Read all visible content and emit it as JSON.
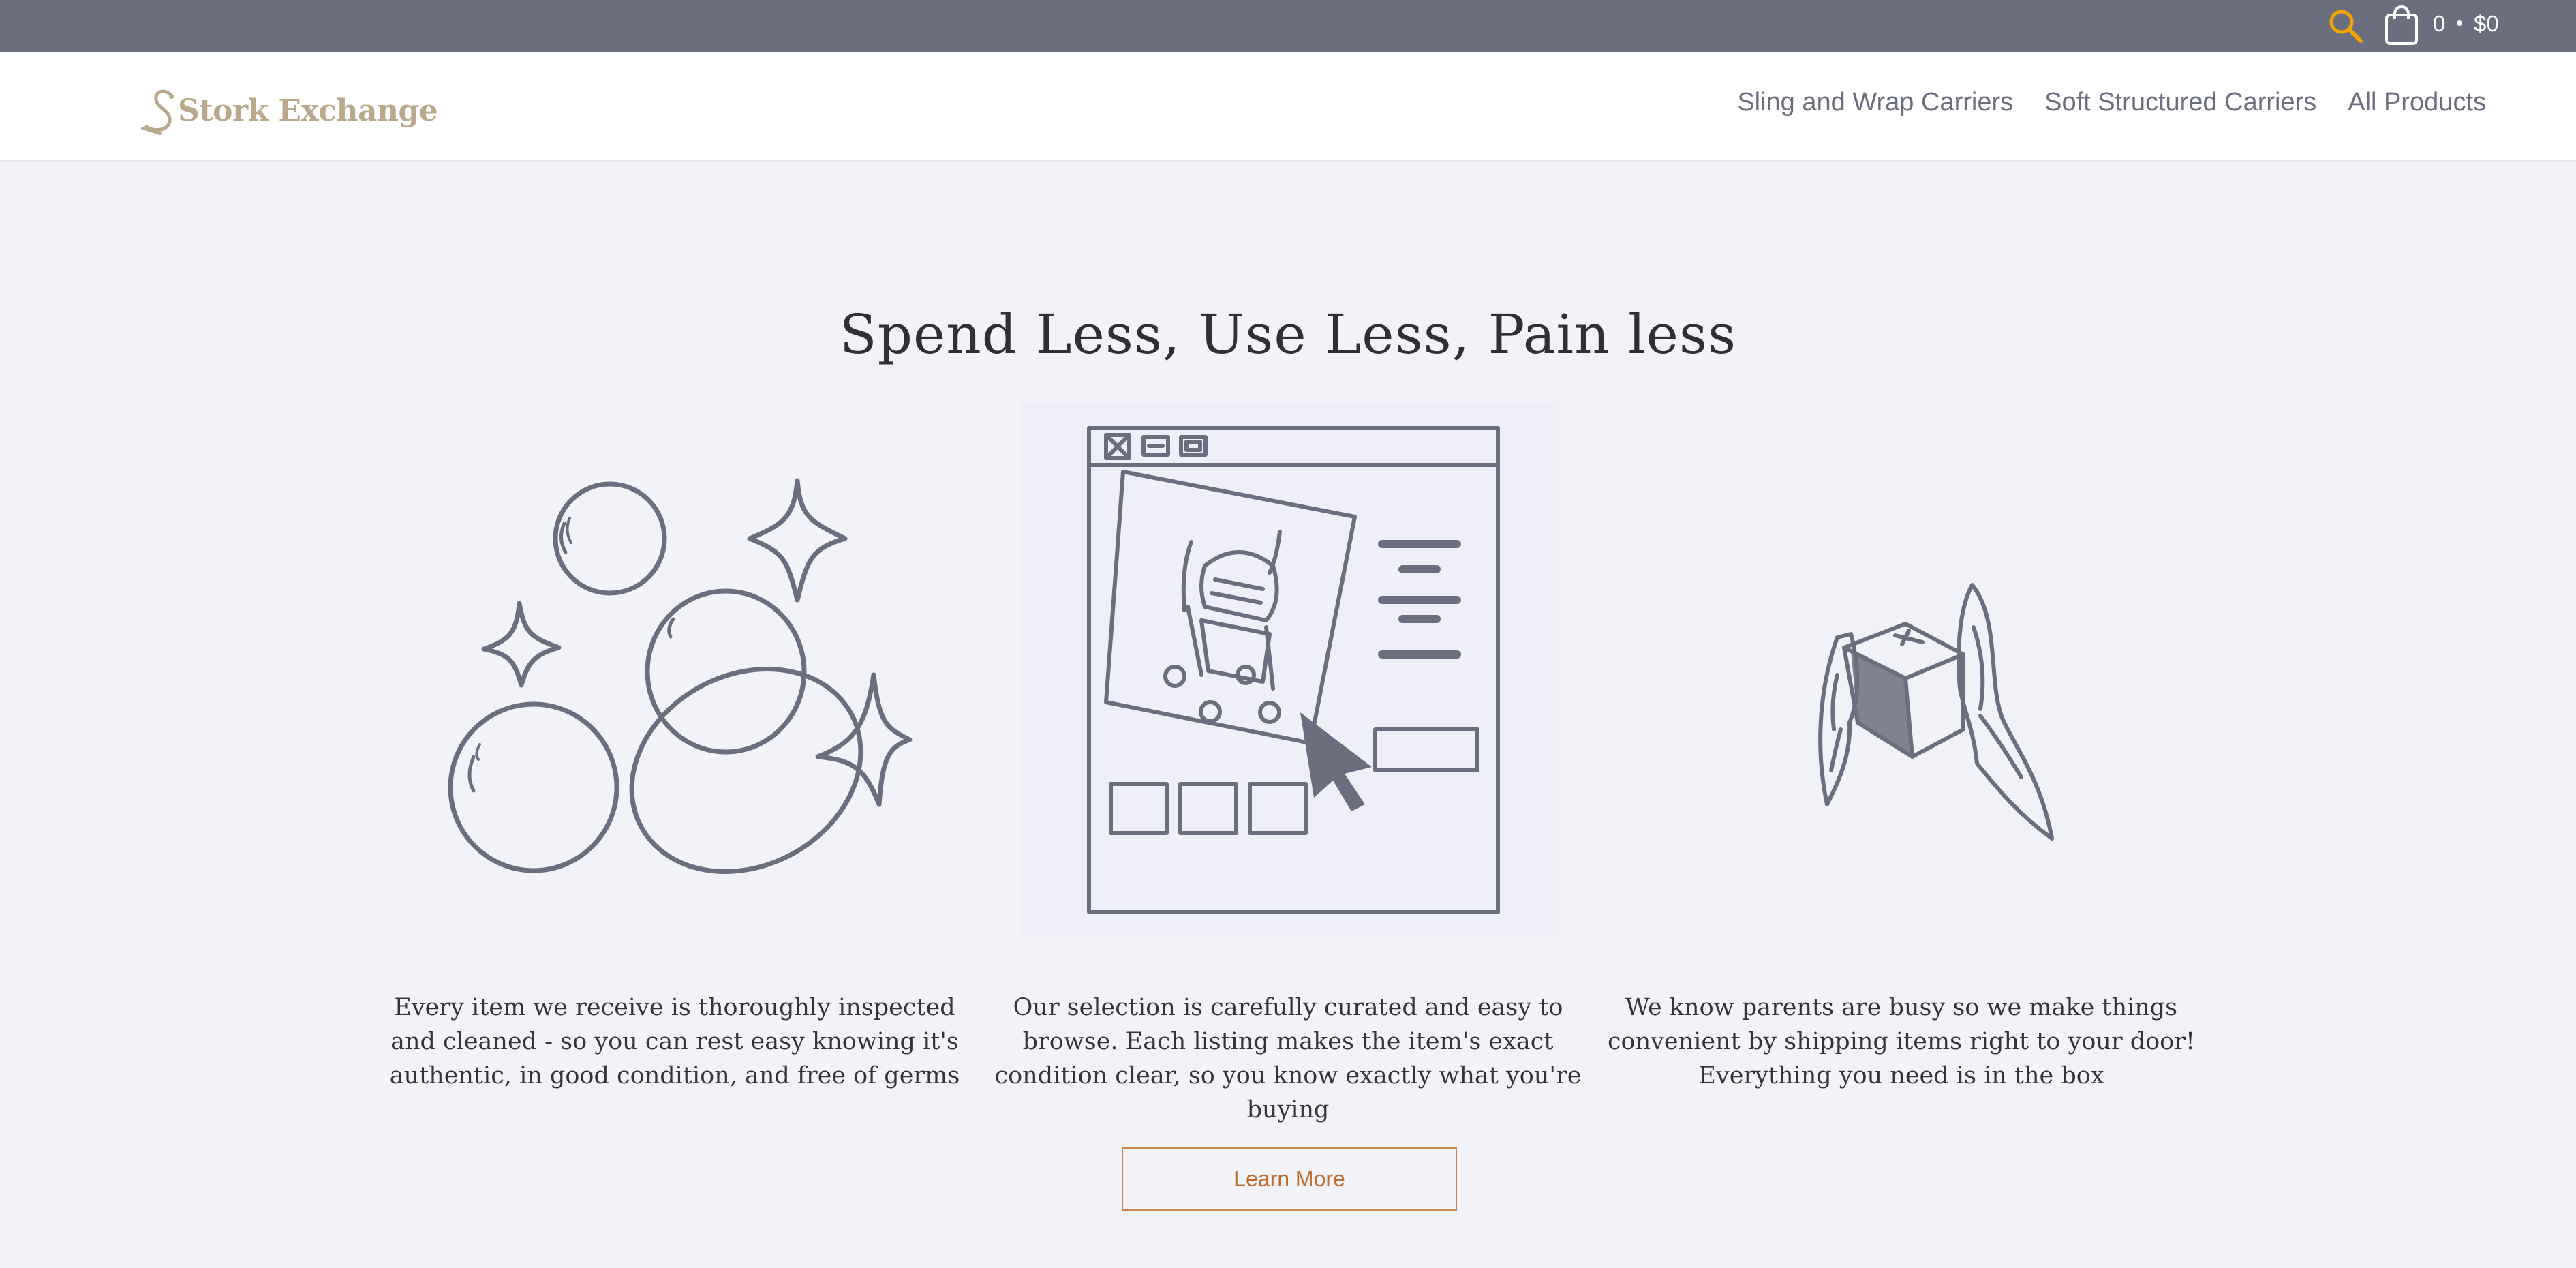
{
  "topbar": {
    "search_icon": "search-icon",
    "cart_icon": "shopping-bag-icon",
    "cart_count": "0",
    "cart_total": "$0",
    "accent_color": "#f2a500"
  },
  "header": {
    "logo_text": "Stork Exchange",
    "logo_color": "#b9a88a",
    "nav": [
      {
        "label": "Sling and Wrap Carriers"
      },
      {
        "label": "Soft Structured Carriers"
      },
      {
        "label": "All Products"
      }
    ]
  },
  "main": {
    "headline": "Spend Less, Use Less, Pain less",
    "features": [
      {
        "icon": "bubbles-sparkle-icon",
        "text": "Every item we receive is thoroughly inspected and cleaned - so you can rest easy knowing it's authentic, in good condition, and free of germs"
      },
      {
        "icon": "stroller-listing-icon",
        "text": "Our selection is carefully curated and easy to browse. Each listing makes the item's exact condition clear, so you know exactly what you're buying"
      },
      {
        "icon": "winged-box-icon",
        "text": "We know parents are busy so we make things convenient by shipping items right to your door! Everything you need is in the box"
      }
    ],
    "cta_label": "Learn More",
    "cta_color": "#c06a2a"
  }
}
